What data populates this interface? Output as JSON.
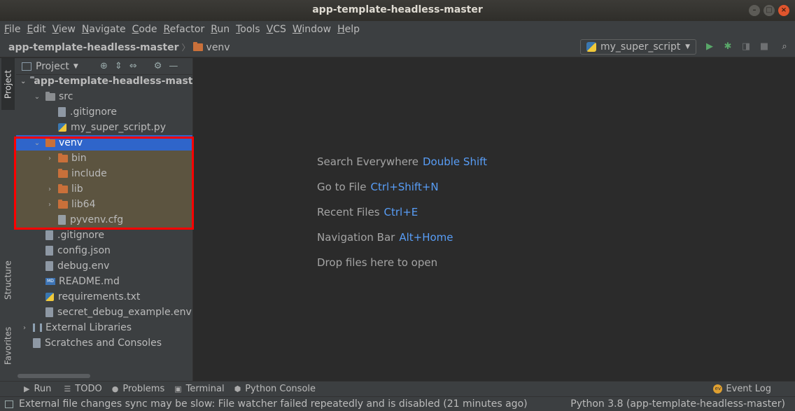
{
  "window": {
    "title": "app-template-headless-master"
  },
  "menu": [
    "File",
    "Edit",
    "View",
    "Navigate",
    "Code",
    "Refactor",
    "Run",
    "Tools",
    "VCS",
    "Window",
    "Help"
  ],
  "breadcrumb": {
    "project": "app-template-headless-master",
    "folder": "venv"
  },
  "run_config": {
    "name": "my_super_script"
  },
  "left_tabs": {
    "project": "Project",
    "structure": "Structure",
    "favorites": "Favorites"
  },
  "project_panel": {
    "title": "Project"
  },
  "tree": [
    {
      "label": "app-template-headless-master",
      "depth": 0,
      "expanded": true,
      "icon": "folder-grey-icon",
      "bold": true
    },
    {
      "label": "src",
      "depth": 1,
      "expanded": true,
      "icon": "folder-grey-icon"
    },
    {
      "label": ".gitignore",
      "depth": 2,
      "icon": "file-icon"
    },
    {
      "label": "my_super_script.py",
      "depth": 2,
      "icon": "python-file-icon"
    },
    {
      "label": "venv",
      "depth": 1,
      "expanded": true,
      "icon": "folder-orange-icon",
      "selected": true
    },
    {
      "label": "bin",
      "depth": 2,
      "collapsed": true,
      "icon": "folder-orange-icon",
      "venv": true
    },
    {
      "label": "include",
      "depth": 2,
      "icon": "folder-orange-icon",
      "venv": true
    },
    {
      "label": "lib",
      "depth": 2,
      "collapsed": true,
      "icon": "folder-orange-icon",
      "venv": true
    },
    {
      "label": "lib64",
      "depth": 2,
      "collapsed": true,
      "icon": "folder-link-icon",
      "venv": true
    },
    {
      "label": "pyvenv.cfg",
      "depth": 2,
      "icon": "file-icon",
      "venv": true
    },
    {
      "label": ".gitignore",
      "depth": 1,
      "icon": "file-icon"
    },
    {
      "label": "config.json",
      "depth": 1,
      "icon": "file-icon"
    },
    {
      "label": "debug.env",
      "depth": 1,
      "icon": "file-icon"
    },
    {
      "label": "README.md",
      "depth": 1,
      "icon": "markdown-icon"
    },
    {
      "label": "requirements.txt",
      "depth": 1,
      "icon": "python-file-icon"
    },
    {
      "label": "secret_debug_example.env",
      "depth": 1,
      "icon": "file-icon"
    },
    {
      "label": "External Libraries",
      "depth": 0,
      "collapsed": true,
      "icon": "library-icon"
    },
    {
      "label": "Scratches and Consoles",
      "depth": 0,
      "icon": "scratches-icon"
    }
  ],
  "welcome": [
    {
      "text": "Search Everywhere",
      "shortcut": "Double Shift"
    },
    {
      "text": "Go to File",
      "shortcut": "Ctrl+Shift+N"
    },
    {
      "text": "Recent Files",
      "shortcut": "Ctrl+E"
    },
    {
      "text": "Navigation Bar",
      "shortcut": "Alt+Home"
    },
    {
      "text": "Drop files here to open",
      "shortcut": ""
    }
  ],
  "bottom_tabs": [
    "Run",
    "TODO",
    "Problems",
    "Terminal",
    "Python Console"
  ],
  "event_log": "Event Log",
  "status": {
    "message": "External file changes sync may be slow: File watcher failed repeatedly and is disabled (21 minutes ago)",
    "interpreter": "Python 3.8 (app-template-headless-master)"
  },
  "colors": {
    "accent": "#589df6",
    "selection": "#2f65ca",
    "highlight_box": "#ff0000",
    "folder": "#c9703a"
  }
}
